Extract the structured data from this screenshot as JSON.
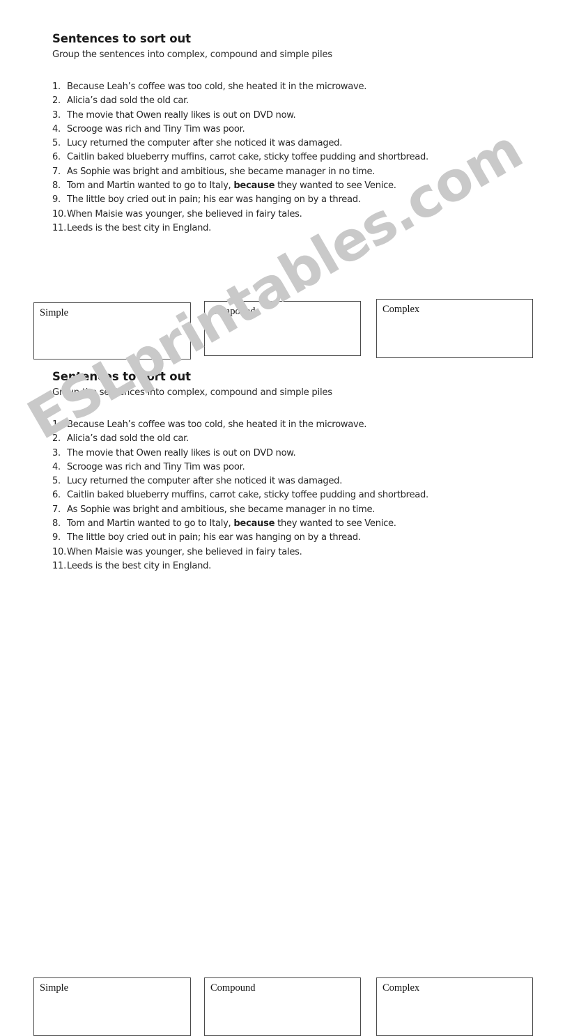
{
  "document": {
    "watermark_text": "ESLprintables.com",
    "watermark_color": "#c9c9c9",
    "page_background": "#ffffff",
    "text_color": "#262626"
  },
  "worksheet": {
    "title": "Sentences to sort out",
    "subtitle": "Group the sentences into complex, compound and simple piles",
    "sentences": [
      {
        "num": "1.",
        "pre": "Because Leah’s coffee was too cold, she heated it in the microwave.",
        "bold": "",
        "post": ""
      },
      {
        "num": "2.",
        "pre": "Alicia’s dad sold the old car.",
        "bold": "",
        "post": ""
      },
      {
        "num": "3.",
        "pre": "The movie that Owen really likes is out on DVD now.",
        "bold": "",
        "post": ""
      },
      {
        "num": "4.",
        "pre": "Scrooge was rich and Tiny Tim was poor.",
        "bold": "",
        "post": ""
      },
      {
        "num": "5.",
        "pre": "Lucy returned the computer after she noticed it was damaged.",
        "bold": "",
        "post": ""
      },
      {
        "num": "6.",
        "pre": "Caitlin baked blueberry muffins, carrot cake, sticky toffee pudding and shortbread.",
        "bold": "",
        "post": ""
      },
      {
        "num": "7.",
        "pre": "As Sophie was bright and ambitious, she became manager in no time.",
        "bold": "",
        "post": ""
      },
      {
        "num": "8.",
        "pre": "Tom and Martin wanted to go to Italy, ",
        "bold": "because",
        "post": " they wanted to see Venice."
      },
      {
        "num": "9.",
        "pre": "The little boy cried out in pain; his ear was hanging on by a thread.",
        "bold": "",
        "post": ""
      },
      {
        "num": "10.",
        "pre": "When Maisie was younger, she believed in fairy tales.",
        "bold": "",
        "post": ""
      },
      {
        "num": "11.",
        "pre": "Leeds is the best city in England.",
        "bold": "",
        "post": ""
      }
    ],
    "boxes": [
      {
        "label": "Simple"
      },
      {
        "label": "Compound"
      },
      {
        "label": "Complex"
      }
    ]
  }
}
